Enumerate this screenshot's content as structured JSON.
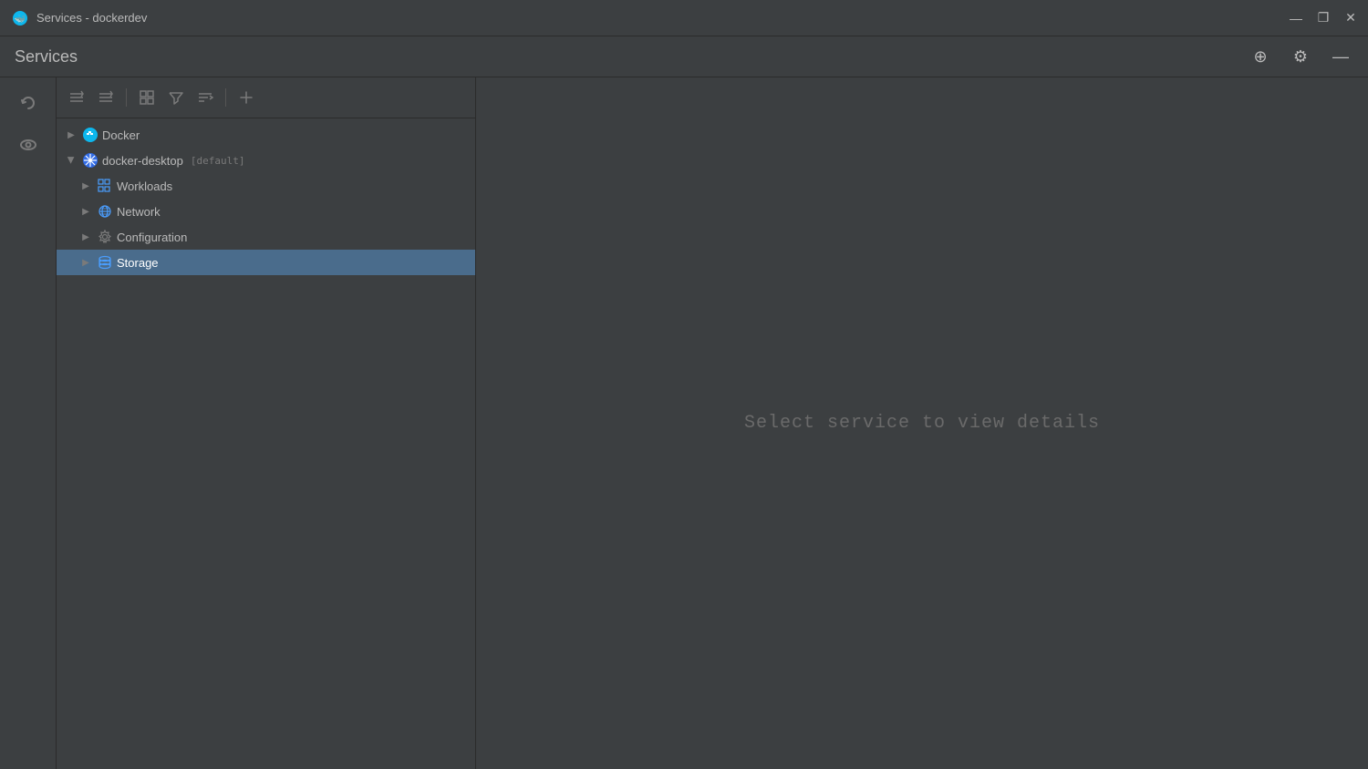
{
  "window": {
    "title": "Services - dockerdev",
    "icon": "🐳"
  },
  "title_bar": {
    "title": "Services - dockerdev",
    "minimize": "—",
    "maximize": "❐",
    "close": "✕"
  },
  "header": {
    "title": "Services",
    "add_label": "⊕",
    "settings_label": "⚙",
    "minimize_label": "—"
  },
  "toolbar": {
    "refresh_label": "↻",
    "collapse_all_label": "≡↑",
    "expand_all_label": "≡↓",
    "group_label": "⊞",
    "filter_label": "⊻",
    "sort_label": "⊼",
    "add_label": "+"
  },
  "tree": {
    "items": [
      {
        "id": "docker",
        "label": "Docker",
        "indent": 0,
        "icon": "docker",
        "arrow": "collapsed",
        "selected": false
      },
      {
        "id": "docker-desktop",
        "label": "docker-desktop",
        "tag": "[default]",
        "indent": 0,
        "icon": "k8s",
        "arrow": "expanded",
        "selected": false
      },
      {
        "id": "workloads",
        "label": "Workloads",
        "indent": 1,
        "icon": "workloads",
        "arrow": "collapsed",
        "selected": false
      },
      {
        "id": "network",
        "label": "Network",
        "indent": 1,
        "icon": "network",
        "arrow": "collapsed",
        "selected": false
      },
      {
        "id": "configuration",
        "label": "Configuration",
        "indent": 1,
        "icon": "config",
        "arrow": "collapsed",
        "selected": false
      },
      {
        "id": "storage",
        "label": "Storage",
        "indent": 1,
        "icon": "storage",
        "arrow": "collapsed",
        "selected": true
      }
    ]
  },
  "content": {
    "empty_hint": "Select service to view details"
  }
}
